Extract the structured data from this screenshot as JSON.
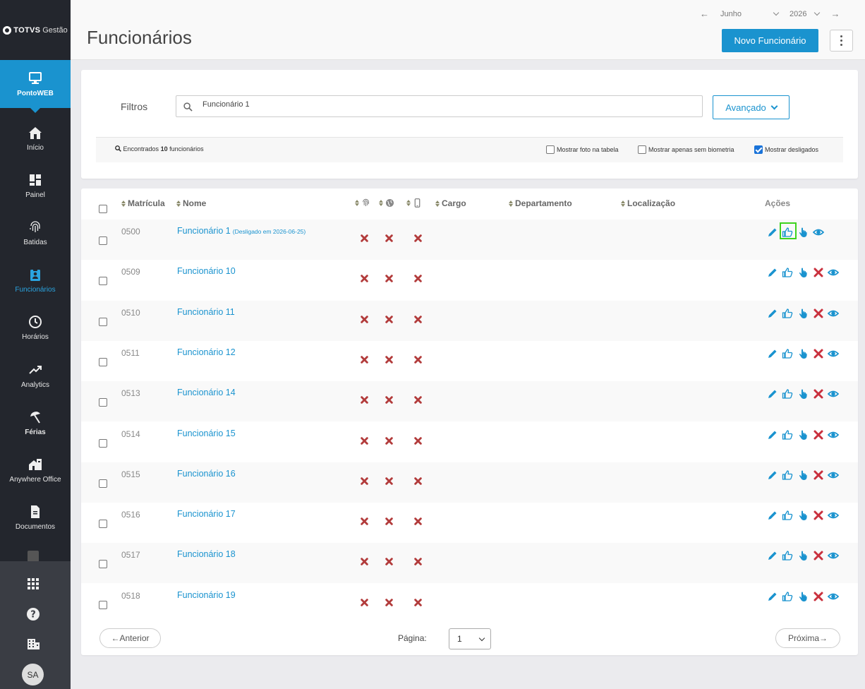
{
  "sidebar": {
    "logo_brand": "TOTVS",
    "logo_sub": "Gestão",
    "items": [
      {
        "label": "PontoWEB"
      },
      {
        "label": "Início"
      },
      {
        "label": "Painel"
      },
      {
        "label": "Batidas"
      },
      {
        "label": "Funcionários"
      },
      {
        "label": "Horários"
      },
      {
        "label": "Analytics"
      },
      {
        "label": "Férias"
      },
      {
        "label": "Anywhere Office"
      },
      {
        "label": "Documentos"
      }
    ],
    "avatar": "SA"
  },
  "header": {
    "title": "Funcionários",
    "month": "Junho",
    "year": "2026",
    "new_button": "Novo Funcionário"
  },
  "filters": {
    "label": "Filtros",
    "search_value": "Funcionário 1",
    "advanced_button": "Avançado",
    "found_prefix": "Encontrados",
    "found_count": "10",
    "found_suffix": "funcionários",
    "options": [
      {
        "label": "Mostrar foto na tabela",
        "checked": false
      },
      {
        "label": "Mostrar apenas sem biometria",
        "checked": false
      },
      {
        "label": "Mostrar desligados",
        "checked": true
      }
    ]
  },
  "table": {
    "columns": {
      "matricula": "Matrícula",
      "nome": "Nome",
      "cargo": "Cargo",
      "departamento": "Departamento",
      "localizacao": "Localização",
      "acoes": "Ações"
    },
    "rows": [
      {
        "matricula": "0500",
        "nome": "Funcionário 1",
        "note": "(Desligado em 2026-06-25)"
      },
      {
        "matricula": "0509",
        "nome": "Funcionário 10",
        "note": ""
      },
      {
        "matricula": "0510",
        "nome": "Funcionário 11",
        "note": ""
      },
      {
        "matricula": "0511",
        "nome": "Funcionário 12",
        "note": ""
      },
      {
        "matricula": "0513",
        "nome": "Funcionário 14",
        "note": ""
      },
      {
        "matricula": "0514",
        "nome": "Funcionário 15",
        "note": ""
      },
      {
        "matricula": "0515",
        "nome": "Funcionário 16",
        "note": ""
      },
      {
        "matricula": "0516",
        "nome": "Funcionário 17",
        "note": ""
      },
      {
        "matricula": "0517",
        "nome": "Funcionário 18",
        "note": ""
      },
      {
        "matricula": "0518",
        "nome": "Funcionário 19",
        "note": ""
      }
    ]
  },
  "pagination": {
    "prev": "←Anterior",
    "page_label": "Página:",
    "page_value": "1",
    "next": "Próxima→"
  },
  "colors": {
    "accent": "#1a93cf",
    "sidebar": "#23262d",
    "error": "#b23b3b",
    "highlight": "#3ed31e"
  }
}
